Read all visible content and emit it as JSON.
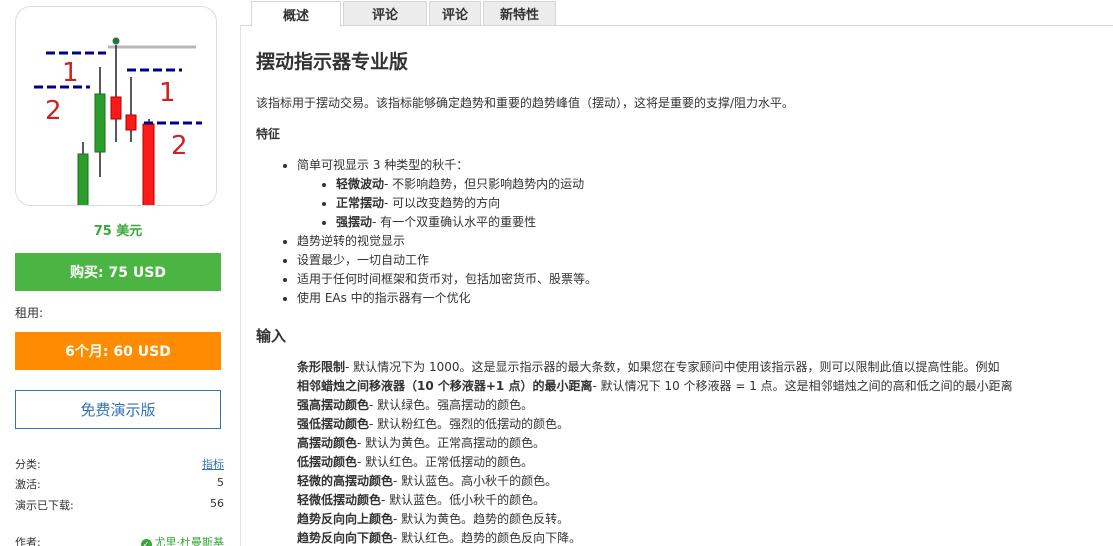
{
  "sidebar": {
    "logo": {
      "label_1_left": "1",
      "label_2_left": "2",
      "label_1_right": "1",
      "label_2_right": "2",
      "colors": {
        "bull": "#2a9d2a",
        "bear": "#ff1a1a",
        "level": "#00008b",
        "label": "#cc2222"
      }
    },
    "price": "75 美元",
    "buy_label": "购买: 75 USD",
    "rent_label": "租用:",
    "rent_button_label": "6个月: 60 USD",
    "demo_label": "免费演示版",
    "meta": {
      "category_label": "分类:",
      "category_value": "指标",
      "activations_label": "激活:",
      "activations_value": "5",
      "demo_downloads_label": "演示已下载:",
      "demo_downloads_value": "56",
      "author_label": "作者:",
      "author_value": "尤里·杜曼斯基"
    }
  },
  "tabs": [
    {
      "label": "概述",
      "active": true
    },
    {
      "label": "评论",
      "active": false
    },
    {
      "label": "评论",
      "active": false
    },
    {
      "label": "新特性",
      "active": false
    }
  ],
  "main": {
    "title": "摆动指示器专业版",
    "intro": "该指标用于摆动交易。该指标能够确定趋势和重要的趋势峰值（摆动），这将是重要的支撑/阻力水平。",
    "features_heading": "特征",
    "features": [
      {
        "text": "简单可视显示 3 种类型的秋千："
      }
    ],
    "sub_features": [
      {
        "bold": "轻微波动",
        "text": "- 不影响趋势，但只影响趋势内的运动"
      },
      {
        "bold": "正常摆动",
        "text": "- 可以改变趋势的方向"
      },
      {
        "bold": "强摆动",
        "text": "- 有一个双重确认水平的重要性"
      }
    ],
    "features_2": [
      {
        "text": "趋势逆转的视觉显示"
      },
      {
        "text": "设置最少，一切自动工作"
      },
      {
        "text": "适用于任何时间框架和货币对，包括加密货币、股票等。"
      },
      {
        "text": "使用 EAs 中的指示器有一个优化"
      }
    ],
    "inputs_heading": "输入",
    "inputs": [
      {
        "bold": "条形限制",
        "text": "- 默认情况下为 1000。这是显示指示器的最大条数，如果您在专家顾问中使用该指示器，则可以限制此值以提高性能。例如"
      },
      {
        "bold": "相邻蜡烛之间移液器（10 个移液器+1 点）的最小距离",
        "text": "- 默认情况下 10 个移液器 = 1 点。这是相邻蜡烛之间的高和低之间的最小距离"
      },
      {
        "bold": "强高摆动颜色",
        "text": "- 默认绿色。强高摆动的颜色。"
      },
      {
        "bold": "强低摆动颜色",
        "text": "- 默认粉红色。强烈的低摆动的颜色。"
      },
      {
        "bold": "高摆动颜色",
        "text": "- 默认为黄色。正常高摆动的颜色。"
      },
      {
        "bold": "低摆动颜色",
        "text": "- 默认红色。正常低摆动的颜色。"
      },
      {
        "bold": "轻微的高摆动颜色",
        "text": "- 默认蓝色。高小秋千的颜色。"
      },
      {
        "bold": "轻微低摆动颜色",
        "text": "- 默认蓝色。低小秋千的颜色。"
      },
      {
        "bold": "趋势反向向上颜色",
        "text": "- 默认为黄色。趋势的颜色反转。"
      },
      {
        "bold": "趋势反向向下颜色",
        "text": "- 默认红色。趋势的颜色反向下降。"
      }
    ]
  }
}
